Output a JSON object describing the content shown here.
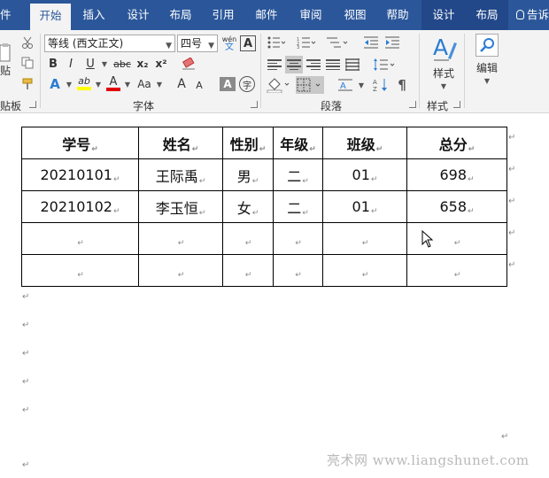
{
  "tabs": [
    {
      "label": "件"
    },
    {
      "label": "开始"
    },
    {
      "label": "插入"
    },
    {
      "label": "设计"
    },
    {
      "label": "布局"
    },
    {
      "label": "引用"
    },
    {
      "label": "邮件"
    },
    {
      "label": "审阅"
    },
    {
      "label": "视图"
    },
    {
      "label": "帮助"
    },
    {
      "label": "设计"
    },
    {
      "label": "布局"
    }
  ],
  "tell_me": "告诉",
  "ribbon": {
    "clipboard": {
      "paste": "贴",
      "label": "贴板"
    },
    "font": {
      "font_name": "等线 (西文正文)",
      "font_size": "四号",
      "phonetic_top": "wén",
      "phonetic_bottom": "文",
      "border_char": "A",
      "bold": "B",
      "italic": "I",
      "underline": "U",
      "strike": "abc",
      "subscript": "x₂",
      "superscript": "x²",
      "text_effect": "A",
      "highlight": "ab",
      "font_color": "A",
      "change_case": "Aa",
      "grow": "A",
      "shrink": "A",
      "shading_char": "A",
      "enclose_char": "字",
      "label": "字体"
    },
    "paragraph": {
      "label": "段落"
    },
    "styles": {
      "button": "样式",
      "label": "样式"
    },
    "editing": {
      "button": "编辑"
    }
  },
  "table": {
    "headers": [
      "学号",
      "姓名",
      "性别",
      "年级",
      "班级",
      "总分"
    ],
    "rows": [
      [
        "20210101",
        "王际禹",
        "男",
        "二",
        "01",
        "698"
      ],
      [
        "20210102",
        "李玉恒",
        "女",
        "二",
        "01",
        "658"
      ],
      [
        "",
        "",
        "",
        "",
        "",
        ""
      ],
      [
        "",
        "",
        "",
        "",
        "",
        ""
      ]
    ]
  },
  "marks": {
    "cell": "↵",
    "para": "↵"
  },
  "watermark": "亮术网 www.liangshunet.com",
  "colors": {
    "tab_bar": "#2b579a",
    "ribbon_bg": "#f3f3f3",
    "highlight_yellow": "#ffff00",
    "font_red": "#e00000",
    "accent_blue": "#2b7cd3"
  }
}
